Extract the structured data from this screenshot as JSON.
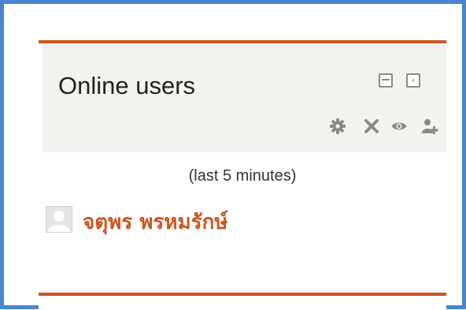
{
  "block": {
    "title": "Online users",
    "controls": [
      {
        "name": "hide-block-icon"
      },
      {
        "name": "dock-block-icon"
      }
    ],
    "actions": [
      {
        "name": "gear-icon"
      },
      {
        "name": "close-icon"
      },
      {
        "name": "eye-icon"
      },
      {
        "name": "assign-roles-icon"
      }
    ],
    "subtitle": "(last 5 minutes)",
    "users": [
      {
        "name": "จตุพร พรหมรักษ์",
        "avatar": "default-user-avatar"
      }
    ]
  },
  "colors": {
    "frame_border": "#4a84cf",
    "accent": "#cc5520",
    "header_bg": "#f4f2ee",
    "icon_gray": "#8a8a8a"
  }
}
